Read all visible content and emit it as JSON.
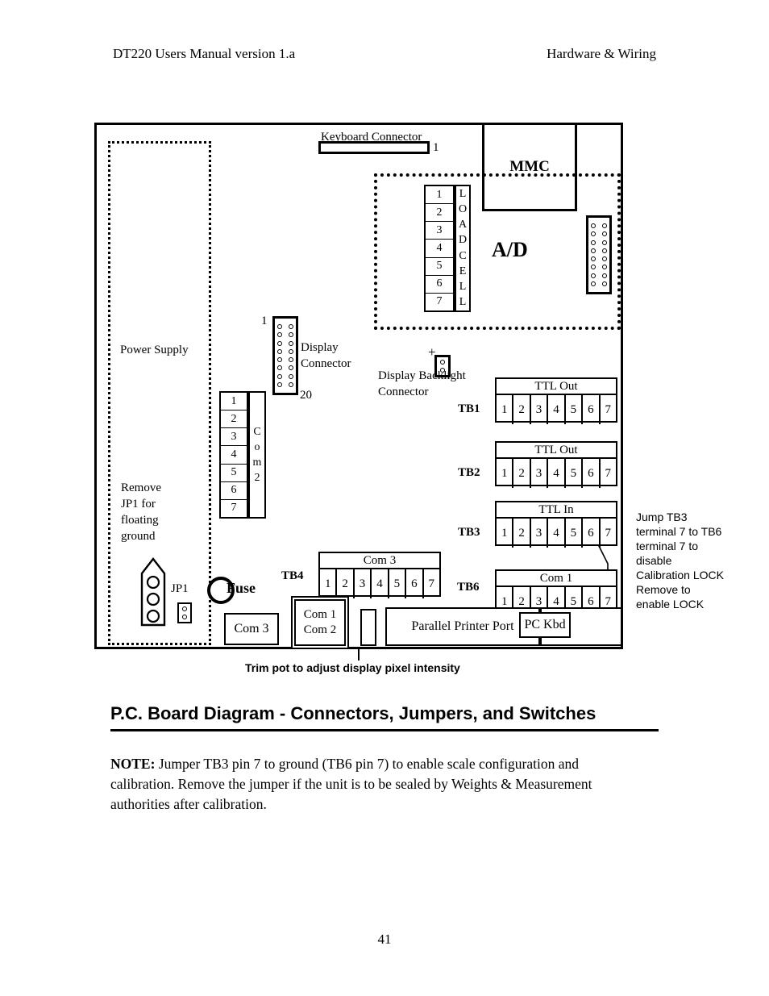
{
  "header": {
    "left": "DT220 Users Manual version 1.a",
    "right": "Hardware & Wiring"
  },
  "board": {
    "power_supply_label": "Power Supply",
    "remove_jp1_label": "Remove\nJP1 for\nfloating\nground",
    "keyboard_connector": {
      "caption": "Keyboard Connector",
      "pin_label": "1"
    },
    "mmc_label": "MMC",
    "ad_label": "A/D",
    "loadcell": {
      "pins": [
        "1",
        "2",
        "3",
        "4",
        "5",
        "6",
        "7"
      ],
      "word": "LOADCELL"
    },
    "display_connector": {
      "label": "Display\nConnector",
      "first_pin": "1",
      "last_pin": "20"
    },
    "display_backlight": {
      "plus": "+",
      "label": "Display Backlight\nConnector"
    },
    "com2_strip": {
      "pins": [
        "1",
        "2",
        "3",
        "4",
        "5",
        "6",
        "7"
      ],
      "word": "Com 2"
    },
    "terminal_blocks": [
      {
        "name": "TB1",
        "title": "TTL Out",
        "pins": [
          "1",
          "2",
          "3",
          "4",
          "5",
          "6",
          "7"
        ]
      },
      {
        "name": "TB2",
        "title": "TTL Out",
        "pins": [
          "1",
          "2",
          "3",
          "4",
          "5",
          "6",
          "7"
        ]
      },
      {
        "name": "TB3",
        "title": "TTL In",
        "pins": [
          "1",
          "2",
          "3",
          "4",
          "5",
          "6",
          "7"
        ]
      },
      {
        "name": "TB4",
        "title": "Com 3",
        "pins": [
          "1",
          "2",
          "3",
          "4",
          "5",
          "6",
          "7"
        ]
      },
      {
        "name": "TB6",
        "title": "Com 1",
        "pins": [
          "1",
          "2",
          "3",
          "4",
          "5",
          "6",
          "7"
        ]
      }
    ],
    "jump_note": "Jump TB3\nterminal 7 to TB6\nterminal 7 to\ndisable\nCalibration LOCK\nRemove to\nenable LOCK",
    "jp1_label": "JP1",
    "fuse_label": "Fuse",
    "bottom_connectors": {
      "com3": "Com 3",
      "com1": "Com 1",
      "com2": "Com 2",
      "parallel_printer_port": "Parallel Printer Port",
      "pc_kbd": "PC Kbd"
    }
  },
  "trim_caption": "Trim pot to adjust display pixel intensity",
  "figure_heading": "P.C. Board Diagram - Connectors, Jumpers, and Switches",
  "note": {
    "prefix": "NOTE:",
    "body": " Jumper TB3 pin 7 to ground (TB6 pin 7) to enable scale configuration and calibration.  Remove the jumper if the unit is to be sealed by Weights & Measurement authorities after calibration."
  },
  "page_number": "41"
}
